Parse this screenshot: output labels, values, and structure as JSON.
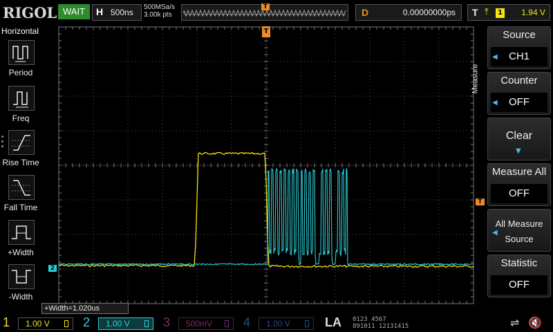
{
  "topbar": {
    "brand": "RIGOL",
    "status": "WAIT",
    "horizontal": {
      "key": "H",
      "value": "500ns"
    },
    "sample_rate": "500MSa/s",
    "memory_depth": "3.00k pts",
    "trigger_position_marker": "T",
    "delay": {
      "key": "D",
      "value": "0.00000000ps"
    },
    "trigger": {
      "key": "T",
      "edge_icon": "rising-edge-icon",
      "source": "1",
      "level": "1.94 V"
    }
  },
  "left_panel": {
    "title": "Horizontal",
    "items": [
      {
        "label": "Period",
        "icon": "period-icon"
      },
      {
        "label": "Freq",
        "icon": "frequency-icon"
      },
      {
        "label": "Rise Time",
        "icon": "rise-time-icon"
      },
      {
        "label": "Fall Time",
        "icon": "fall-time-icon"
      },
      {
        "label": "+Width",
        "icon": "positive-width-icon"
      },
      {
        "label": "-Width",
        "icon": "negative-width-icon"
      }
    ]
  },
  "screen": {
    "ch2_marker": "2",
    "trigger_marker": "T",
    "trigger_level_marker": "T",
    "measurement": "+Width=1.020us"
  },
  "right_menu": {
    "vertical_label": "Measure",
    "items": [
      {
        "title": "Source",
        "value": "CH1"
      },
      {
        "title": "Counter",
        "value": "OFF"
      },
      {
        "title": "Clear"
      },
      {
        "title": "Measure All",
        "value": "OFF"
      },
      {
        "title_line1": "All Measure",
        "title_line2": "Source"
      },
      {
        "title": "Statistic",
        "value": "OFF"
      }
    ]
  },
  "bottom_bar": {
    "channels": [
      {
        "num": "1",
        "scale": "1.00 V",
        "color": "#f5e50a",
        "active": true
      },
      {
        "num": "2",
        "scale": "1.00 V",
        "color": "#2ad0d8",
        "active": true
      },
      {
        "num": "3",
        "scale": "500mV",
        "color": "#7a2f6a",
        "active": false
      },
      {
        "num": "4",
        "scale": "1.00 V",
        "color": "#2a4a8a",
        "active": false
      }
    ],
    "la_label": "LA",
    "la_row1": "0123 4567",
    "la_row2": "891011 12131415"
  },
  "colors": {
    "ch1": "#f5e50a",
    "ch2": "#2ad0d8",
    "trigger": "#f08a24",
    "wait_status": "#2e8b2e",
    "menu_arrow": "#4fb3f0"
  }
}
